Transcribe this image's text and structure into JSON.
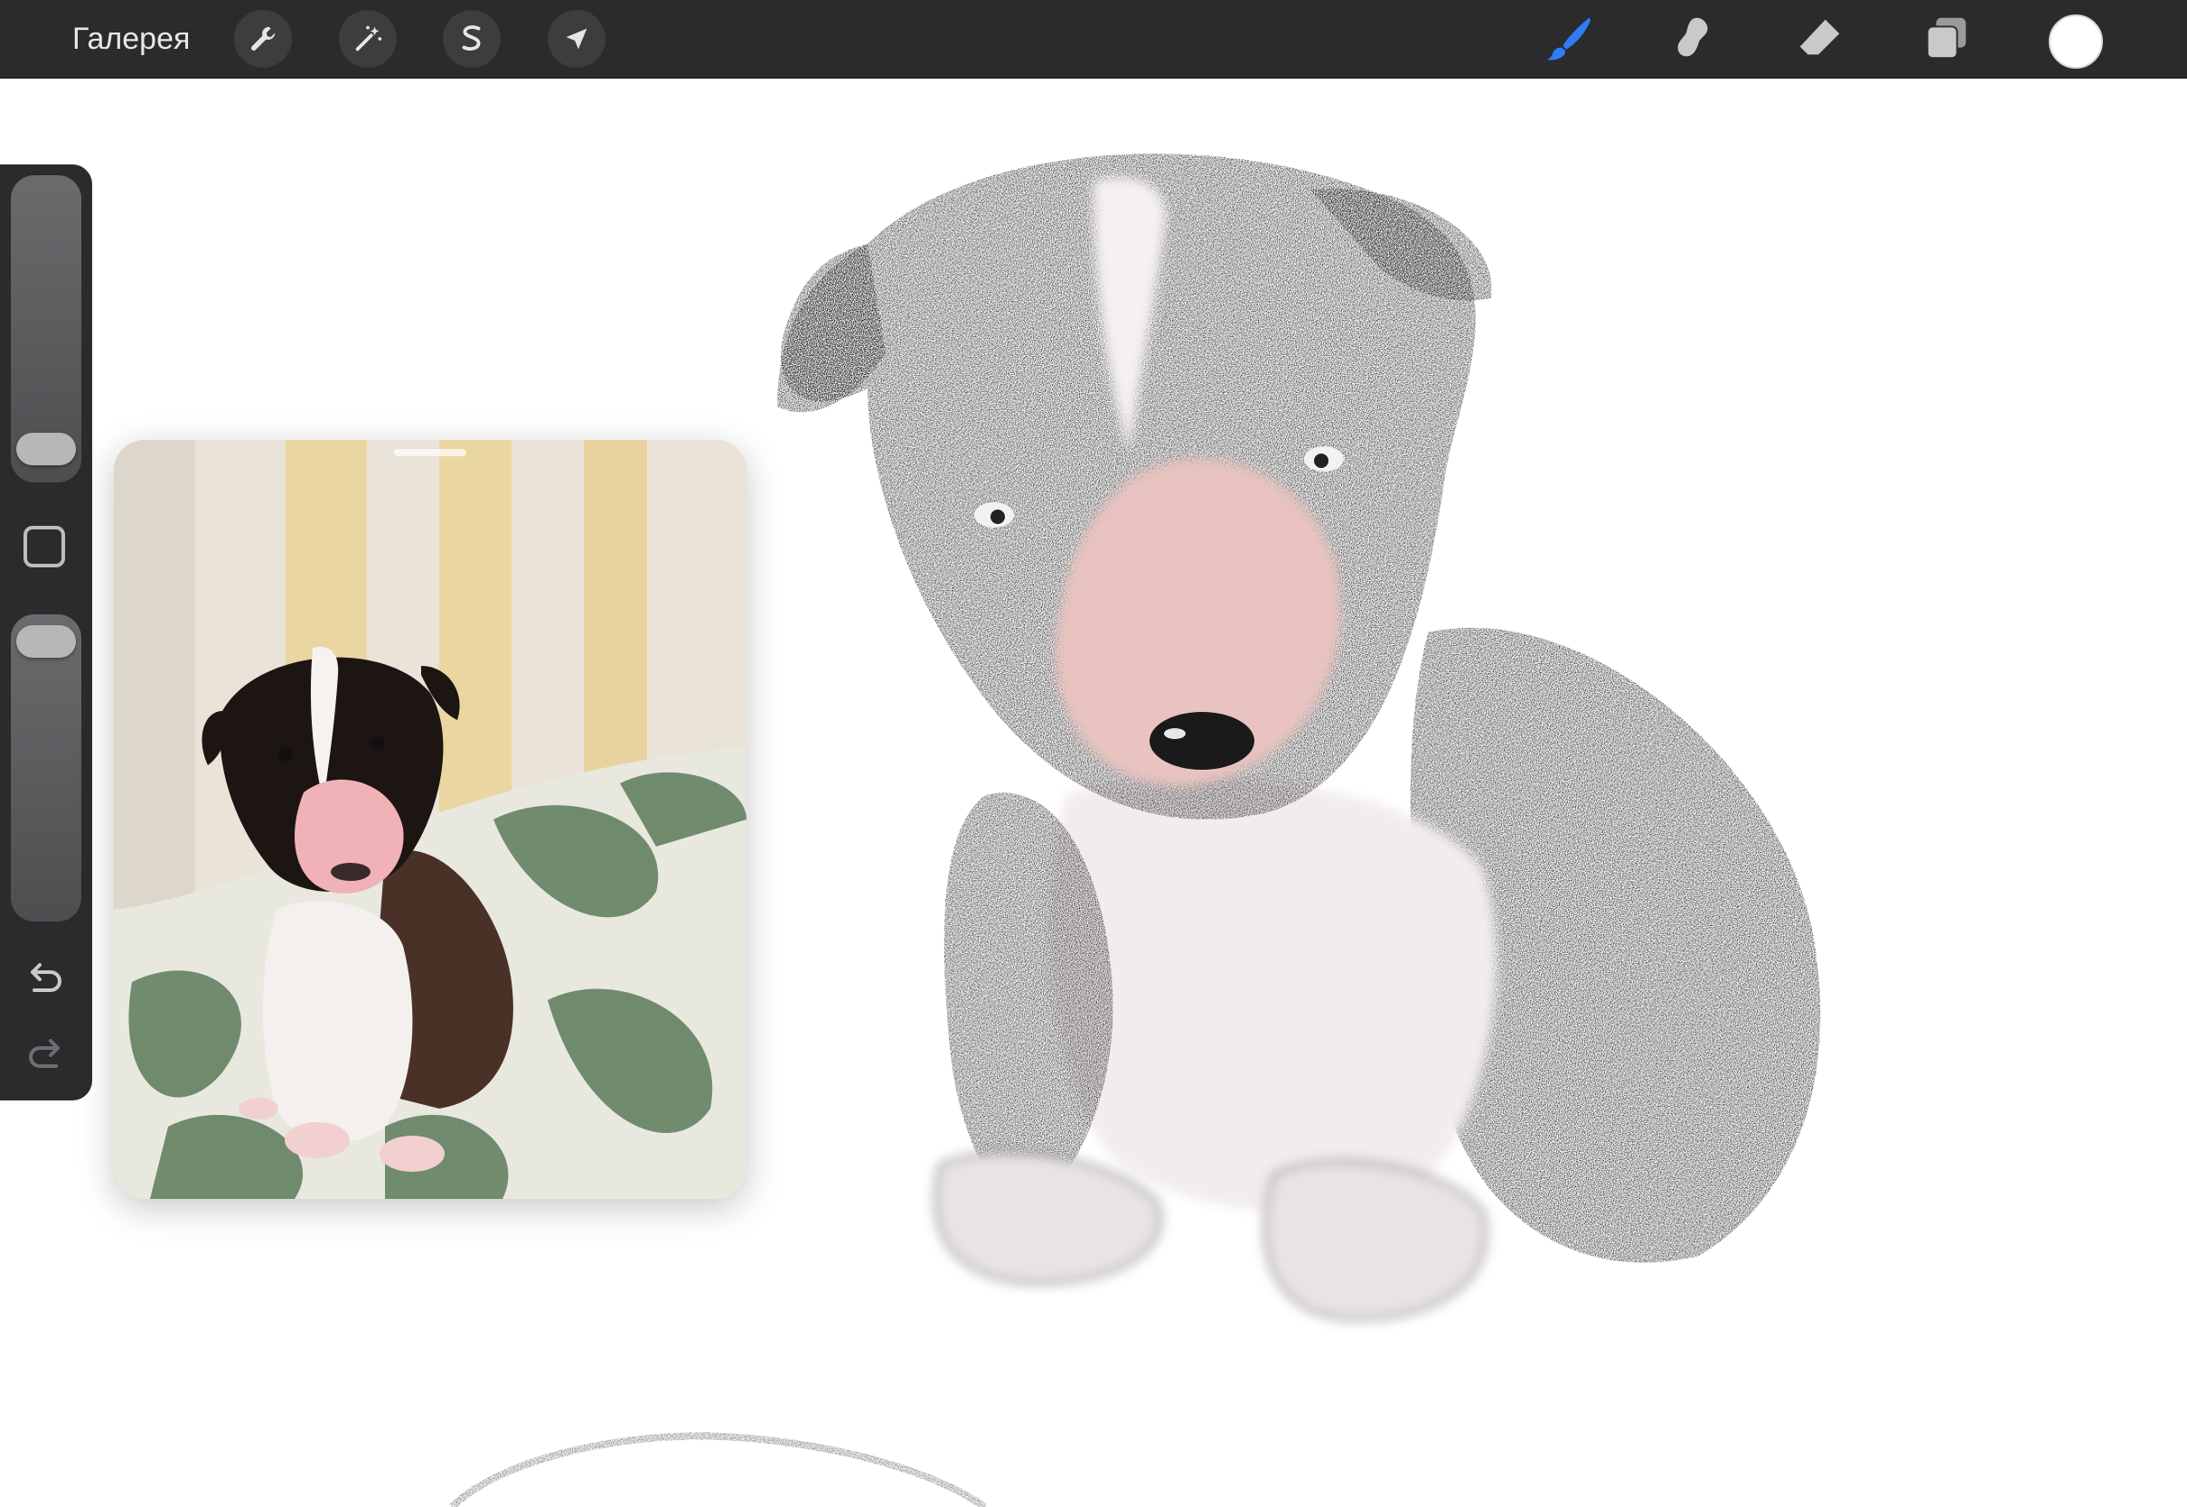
{
  "topbar": {
    "gallery_label": "Галерея",
    "left_tools": [
      {
        "name": "actions",
        "icon": "wrench-icon"
      },
      {
        "name": "adjustments",
        "icon": "magic-wand-icon"
      },
      {
        "name": "selection",
        "icon": "selection-s-icon"
      },
      {
        "name": "transform",
        "icon": "arrow-cursor-icon"
      }
    ],
    "right_tools": [
      {
        "name": "brush",
        "icon": "brush-icon",
        "active": true
      },
      {
        "name": "smudge",
        "icon": "smudge-icon"
      },
      {
        "name": "eraser",
        "icon": "eraser-icon"
      },
      {
        "name": "layers",
        "icon": "layers-icon"
      }
    ],
    "current_color": "#ffffff",
    "active_color": "#2f7cf6"
  },
  "sidebar": {
    "icons": [
      "square-modify-icon",
      "undo-icon",
      "redo-icon"
    ]
  },
  "reference": {
    "subject": "reference-photo-puppy"
  }
}
